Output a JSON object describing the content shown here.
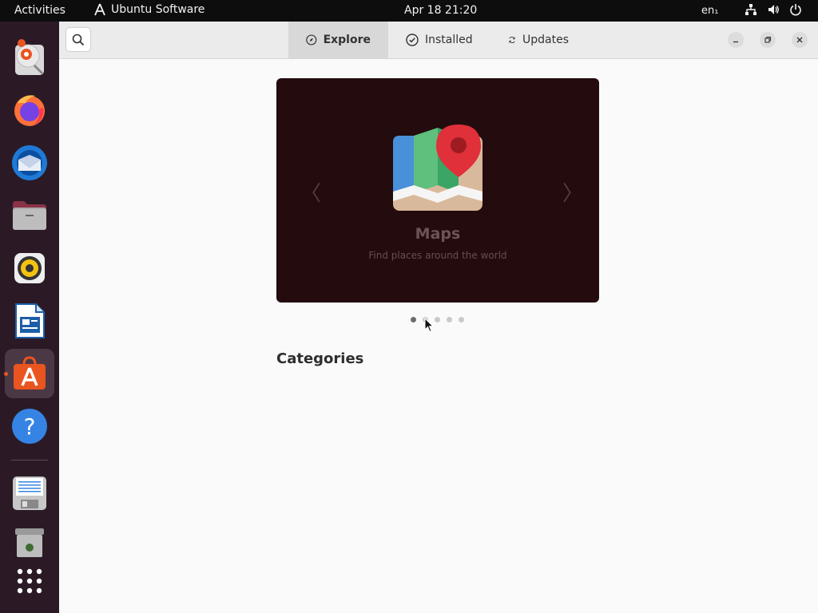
{
  "topbar": {
    "activities": "Activities",
    "app_name": "Ubuntu Software",
    "clock": "Apr 18  21:20",
    "language": "en₁"
  },
  "dock": {
    "items": [
      {
        "name": "Thunderbird",
        "icon": "thunderbird-icon"
      },
      {
        "name": "Firefox",
        "icon": "firefox-icon"
      },
      {
        "name": "Mail",
        "icon": "mail-icon"
      },
      {
        "name": "Files",
        "icon": "folder-icon"
      },
      {
        "name": "Rhythmbox",
        "icon": "speaker-icon"
      },
      {
        "name": "LibreOffice Writer",
        "icon": "writer-icon"
      },
      {
        "name": "Ubuntu Software",
        "icon": "software-bag-icon",
        "active": true
      },
      {
        "name": "Help",
        "icon": "help-icon"
      },
      {
        "name": "Floppy",
        "icon": "floppy-icon"
      },
      {
        "name": "Trash",
        "icon": "trash-icon"
      },
      {
        "name": "Show Applications",
        "icon": "app-grid-icon"
      }
    ]
  },
  "header": {
    "tabs": [
      {
        "label": "Explore",
        "icon": "compass-icon",
        "active": true
      },
      {
        "label": "Installed",
        "icon": "check-circle-icon"
      },
      {
        "label": "Updates",
        "icon": "refresh-icon"
      }
    ]
  },
  "banner": {
    "title": "Maps",
    "subtitle": "Find places around the world",
    "background": "#230b0e",
    "dots_total": 5,
    "dots_active": 0
  },
  "main": {
    "categories_heading": "Categories"
  },
  "colors": {
    "accent": "#e95420",
    "dock_bg": "#2b1a26",
    "topbar_bg": "#0d0d0d"
  }
}
